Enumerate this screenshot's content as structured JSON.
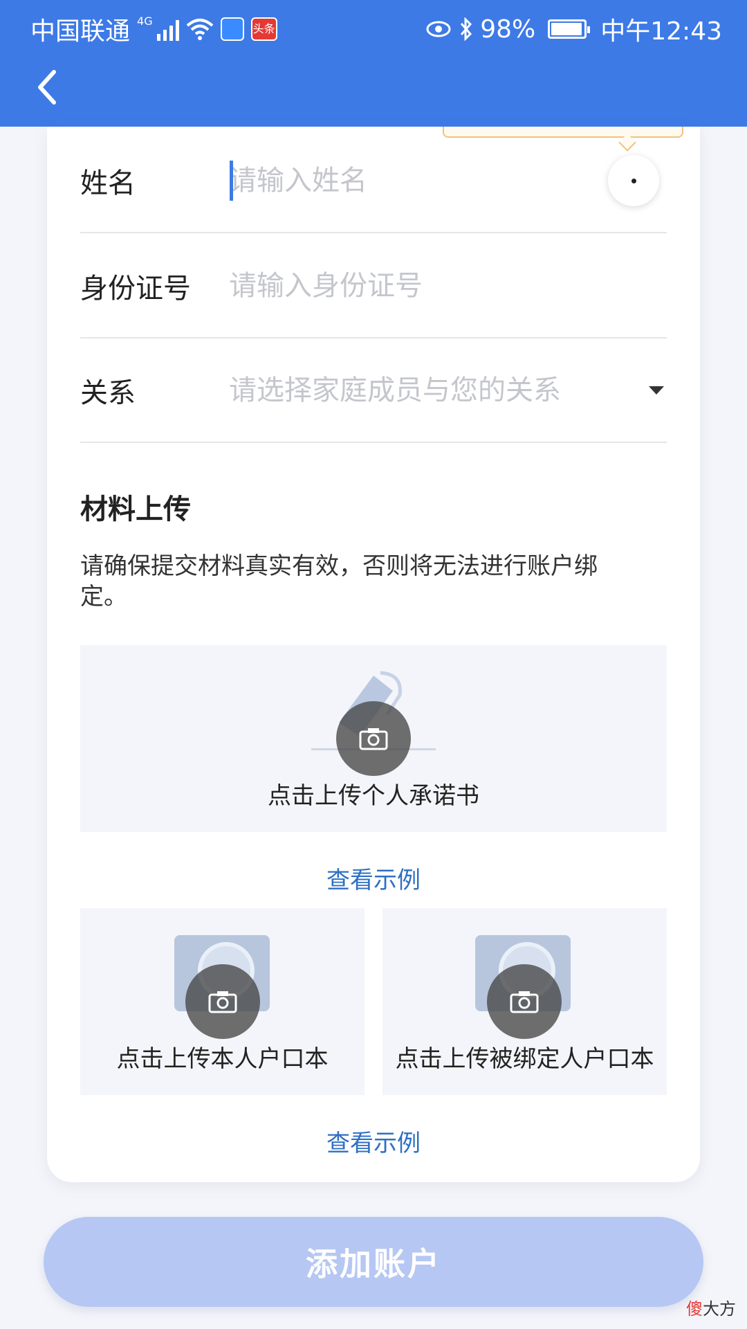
{
  "status_bar": {
    "carrier": "中国联通",
    "network_tag": "4G",
    "battery_percent": "98%",
    "time": "中午12:43",
    "app_badge_text": "头条"
  },
  "header": {
    "back_icon": "chevron-left-icon"
  },
  "form": {
    "name": {
      "label": "姓名",
      "placeholder": "请输入姓名",
      "value": ""
    },
    "id_number": {
      "label": "身份证号",
      "placeholder": "请输入身份证号",
      "value": ""
    },
    "relation": {
      "label": "关系",
      "placeholder": "请选择家庭成员与您的关系",
      "selected": ""
    }
  },
  "materials": {
    "title": "材料上传",
    "description": "请确保提交材料真实有效，否则将无法进行账户绑定。",
    "promise_upload_label": "点击上传个人承诺书",
    "view_example_1": "查看示例",
    "self_hukou_label": "点击上传本人户口本",
    "bound_hukou_label": "点击上传被绑定人户口本",
    "view_example_2": "查看示例"
  },
  "submit": {
    "label": "添加账户"
  },
  "watermark": {
    "first_char": "傻",
    "rest": "大方"
  },
  "colors": {
    "primary": "#3d7ae6",
    "button_disabled": "#b6c7f3",
    "link": "#2e6fc4",
    "placeholder": "#c4c6cc",
    "upload_bg": "#f4f5fa"
  }
}
